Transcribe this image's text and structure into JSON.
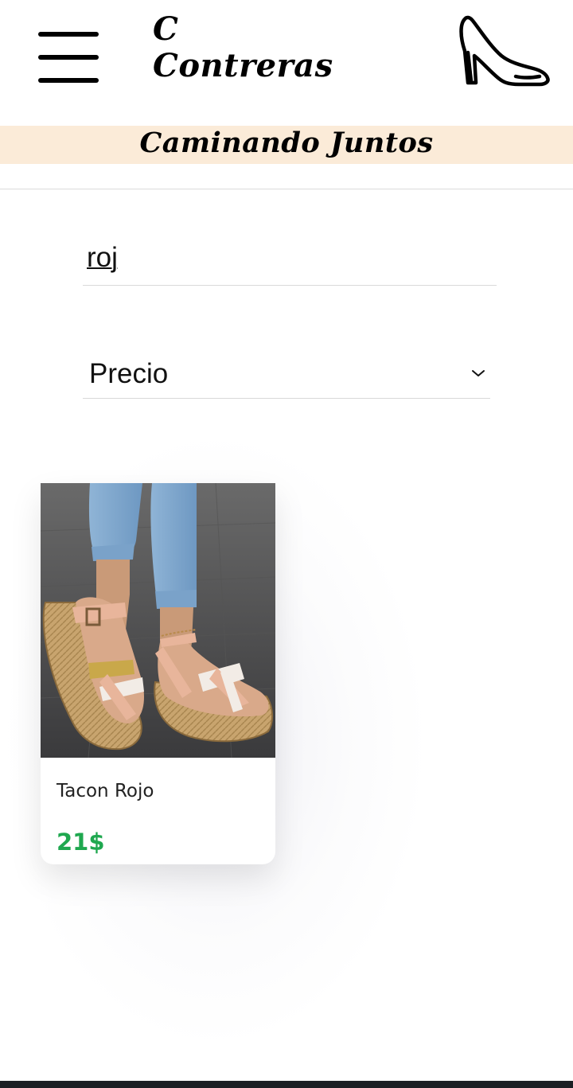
{
  "header": {
    "brand_line1": "C",
    "brand_line2": "Contreras",
    "tagline": "Caminando Juntos",
    "menu_icon": "hamburger-menu-icon",
    "logo_icon": "high-heel-shoe-icon"
  },
  "search": {
    "value": "roj"
  },
  "sort": {
    "selected": "Precio",
    "icon": "chevron-down-icon"
  },
  "products": [
    {
      "name": "Tacon Rojo",
      "price": "21$",
      "price_color": "#1fa84f"
    }
  ],
  "colors": {
    "tagline_bg": "#fbebd8",
    "price": "#1fa84f"
  }
}
